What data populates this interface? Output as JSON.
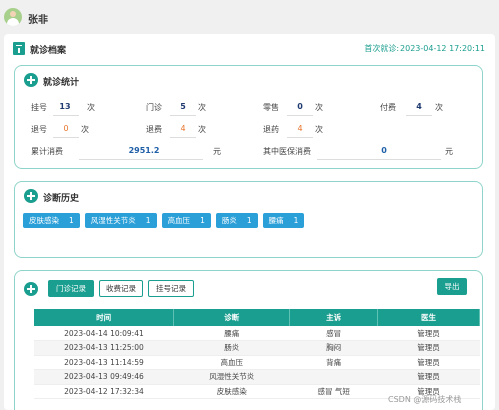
{
  "user": {
    "name": "张非"
  },
  "header": {
    "title": "就诊档案",
    "first_visit_label": "首次就诊:",
    "first_visit_value": "2023-04-12 17:20:11"
  },
  "stats": {
    "title": "就诊统计",
    "items": [
      {
        "label": "挂号",
        "value": "13",
        "unit": "次"
      },
      {
        "label": "门诊",
        "value": "5",
        "unit": "次"
      },
      {
        "label": "零售",
        "value": "0",
        "unit": "次"
      },
      {
        "label": "付费",
        "value": "4",
        "unit": "次"
      },
      {
        "label": "退号",
        "value": "0",
        "unit": "次"
      },
      {
        "label": "退费",
        "value": "4",
        "unit": "次"
      },
      {
        "label": "退药",
        "value": "4",
        "unit": "次"
      },
      {
        "label": "累计消费",
        "value": "2951.2",
        "unit": "元"
      },
      {
        "label": "其中医保消费",
        "value": "0",
        "unit": "元"
      }
    ]
  },
  "history": {
    "title": "诊断历史",
    "tags": [
      {
        "name": "皮肤感染",
        "count": "1"
      },
      {
        "name": "风湿性关节炎",
        "count": "1"
      },
      {
        "name": "高血压",
        "count": "1"
      },
      {
        "name": "肠炎",
        "count": "1"
      },
      {
        "name": "腰痛",
        "count": "1"
      }
    ]
  },
  "records": {
    "tabs": [
      "门诊记录",
      "收费记录",
      "挂号记录"
    ],
    "export_label": "导出",
    "columns": [
      "时间",
      "诊断",
      "主诉",
      "医生"
    ],
    "rows": [
      [
        "2023-04-14 10:09:41",
        "腰痛",
        "感冒",
        "管理员"
      ],
      [
        "2023-04-13 11:25:00",
        "肠炎",
        "胸闷",
        "管理员"
      ],
      [
        "2023-04-13 11:14:59",
        "高血压",
        "背痛",
        "管理员"
      ],
      [
        "2023-04-13 09:49:46",
        "风湿性关节炎",
        "",
        "管理员"
      ],
      [
        "2023-04-12 17:32:34",
        "皮肤感染",
        "感冒 气短",
        "管理员"
      ]
    ]
  },
  "watermark": "CSDN @源码技术栈"
}
